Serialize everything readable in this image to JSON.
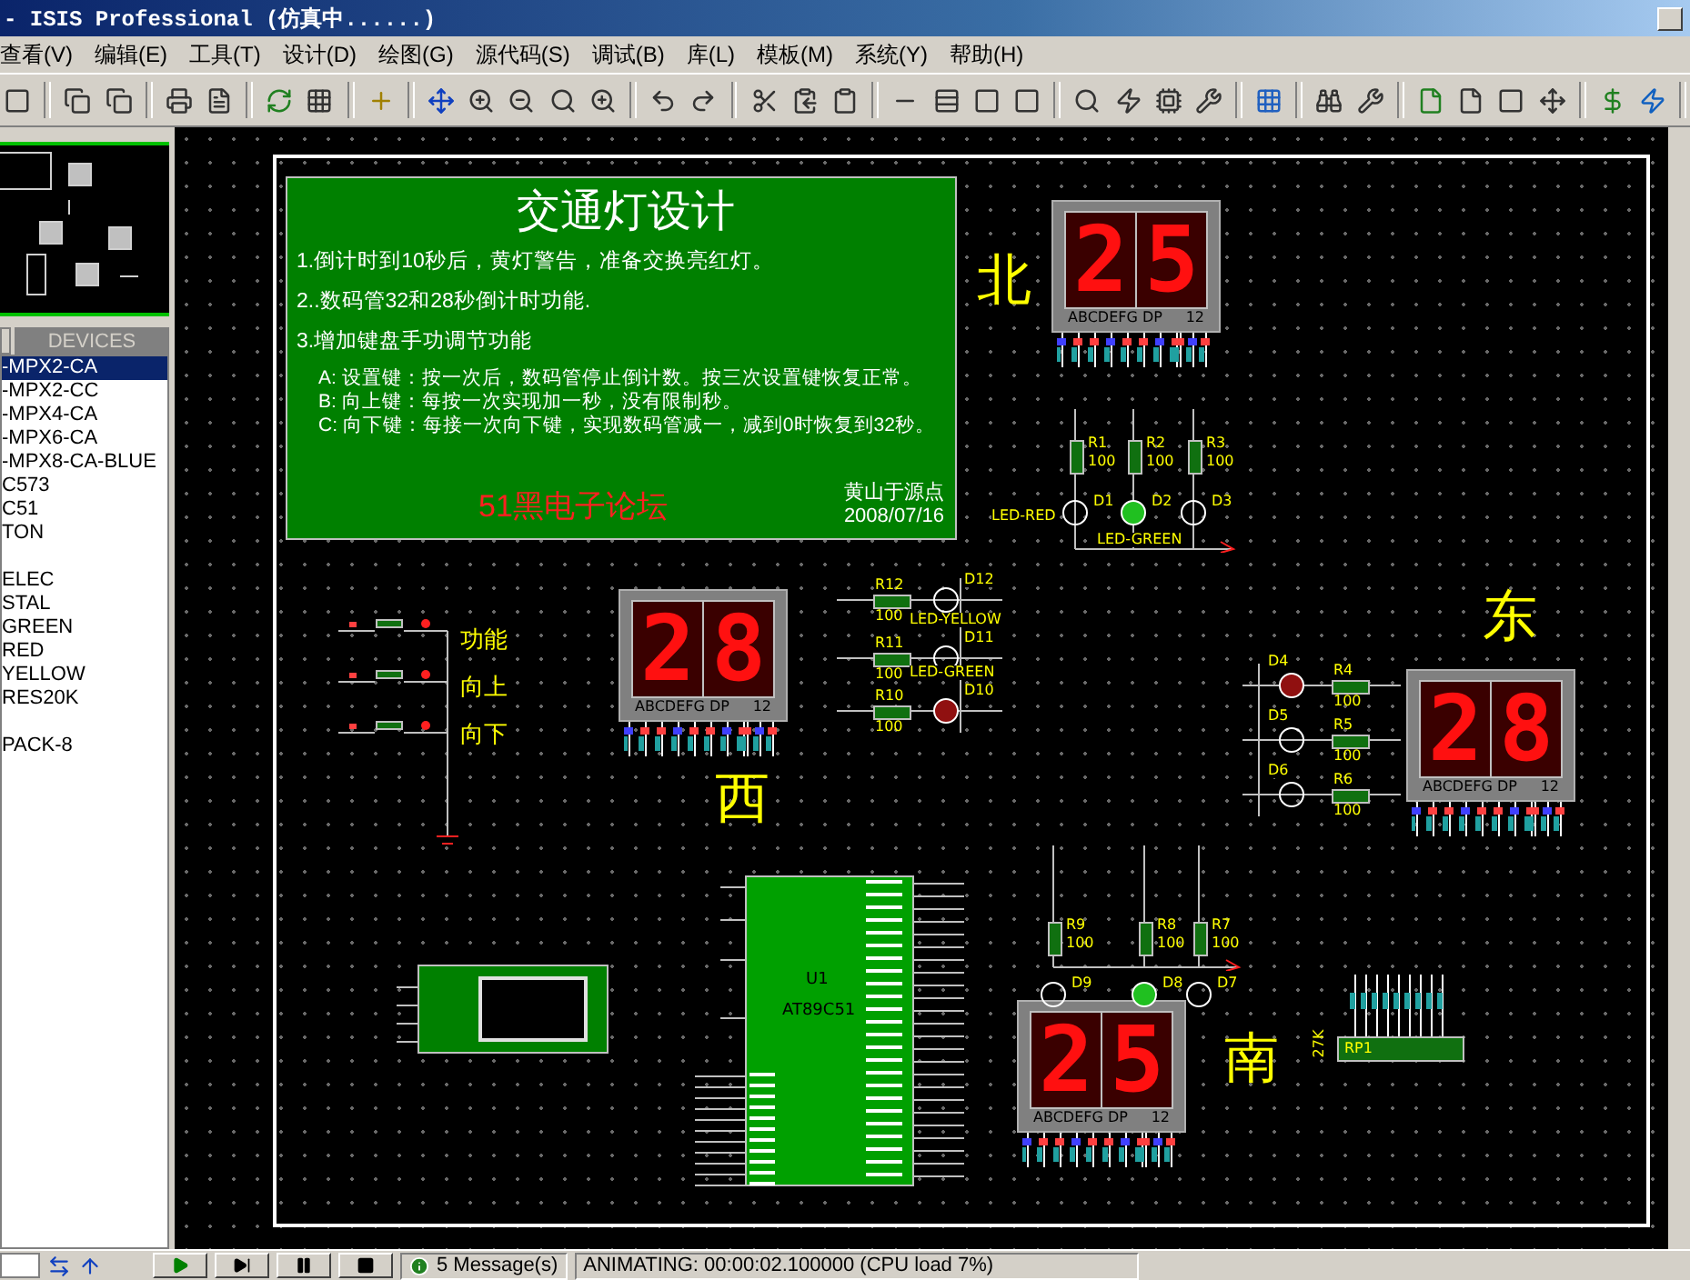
{
  "title_bar": {
    "title": "- ISIS Professional (仿真中......)"
  },
  "menu": [
    "查看(V)",
    "编辑(E)",
    "工具(T)",
    "设计(D)",
    "绘图(G)",
    "源代码(S)",
    "调试(B)",
    "库(L)",
    "模板(M)",
    "系统(Y)",
    "帮助(H)"
  ],
  "devices": {
    "tab": "DEVICES",
    "items": [
      {
        "label": "-MPX2-CA",
        "selected": true
      },
      {
        "label": "-MPX2-CC",
        "selected": false
      },
      {
        "label": "-MPX4-CA",
        "selected": false
      },
      {
        "label": "-MPX6-CA",
        "selected": false
      },
      {
        "label": "-MPX8-CA-BLUE",
        "selected": false
      },
      {
        "label": "C573",
        "selected": false
      },
      {
        "label": "C51",
        "selected": false
      },
      {
        "label": "TON",
        "selected": false
      },
      {
        "label": "ELEC",
        "selected": false
      },
      {
        "label": "STAL",
        "selected": false
      },
      {
        "label": "GREEN",
        "selected": false
      },
      {
        "label": "RED",
        "selected": false
      },
      {
        "label": "YELLOW",
        "selected": false
      },
      {
        "label": "RES20K",
        "selected": false
      },
      {
        "label": "PACK-8",
        "selected": false
      }
    ]
  },
  "info_box": {
    "title": "交通灯设计",
    "lines": [
      "1.倒计时到10秒后，黄灯警告，准备交换亮红灯。",
      "2..数码管32和28秒倒计时功能.",
      "3.增加键盘手功调节功能"
    ],
    "sub_lines": [
      "A: 设置键：按一次后，数码管停止倒计数。按三次设置键恢复正常。",
      "B: 向上键：每按一次实现加一秒，没有限制秒。",
      "C: 向下键：每接一次向下键，实现数码管减一，减到0时恢复到32秒。"
    ],
    "forum": "51黑电子论坛",
    "author": "黄山于源点",
    "date": "2008/07/16"
  },
  "displays": [
    {
      "digits": "25",
      "segments_label": "ABCDEFG DP",
      "common_label": "12",
      "direction": "北"
    },
    {
      "digits": "28",
      "segments_label": "ABCDEFG DP",
      "common_label": "12",
      "direction": "西"
    },
    {
      "digits": "28",
      "segments_label": "ABCDEFG DP",
      "common_label": "12",
      "direction": "东"
    },
    {
      "digits": "25",
      "segments_label": "ABCDEFG DP",
      "common_label": "12",
      "direction": "南"
    }
  ],
  "keys": [
    "功能",
    "向上",
    "向下"
  ],
  "led_groups": [
    {
      "type_labels": [
        "LED-RED",
        "LED-GREEN"
      ],
      "resistors": [
        {
          "ref": "R1",
          "value": "100"
        },
        {
          "ref": "R2",
          "value": "100"
        },
        {
          "ref": "R3",
          "value": "100"
        }
      ],
      "leds": [
        {
          "ref": "D1",
          "lit": false
        },
        {
          "ref": "D2",
          "lit": true,
          "color": "#20c020"
        },
        {
          "ref": "D3",
          "lit": false
        }
      ]
    },
    {
      "type_labels": [
        "LED-YELLOW",
        "LED-GREEN"
      ],
      "resistors": [
        {
          "ref": "R12",
          "value": "100"
        },
        {
          "ref": "R11",
          "value": "100"
        },
        {
          "ref": "R10",
          "value": "100"
        }
      ],
      "leds": [
        {
          "ref": "D12",
          "lit": false
        },
        {
          "ref": "D11",
          "lit": false
        },
        {
          "ref": "D10",
          "lit": true,
          "color": "#901010"
        }
      ]
    },
    {
      "resistors": [
        {
          "ref": "R4",
          "value": "100"
        },
        {
          "ref": "R5",
          "value": "100"
        },
        {
          "ref": "R6",
          "value": "100"
        }
      ],
      "leds": [
        {
          "ref": "D4",
          "lit": true,
          "color": "#901010"
        },
        {
          "ref": "D5",
          "lit": false
        },
        {
          "ref": "D6",
          "lit": false
        }
      ]
    },
    {
      "resistors": [
        {
          "ref": "R9",
          "value": "100"
        },
        {
          "ref": "R8",
          "value": "100"
        },
        {
          "ref": "R7",
          "value": "100"
        }
      ],
      "leds": [
        {
          "ref": "D9",
          "lit": false
        },
        {
          "ref": "D8",
          "lit": true,
          "color": "#20c020"
        },
        {
          "ref": "D7",
          "lit": false
        }
      ]
    }
  ],
  "mcu": {
    "ref": "U1",
    "part": "AT89C51"
  },
  "resistor_pack": {
    "ref": "RP1",
    "value": "27K"
  },
  "status_bar": {
    "messages": "5 Message(s)",
    "status": "ANIMATING: 00:00:02.100000 (CPU load 7%)"
  }
}
